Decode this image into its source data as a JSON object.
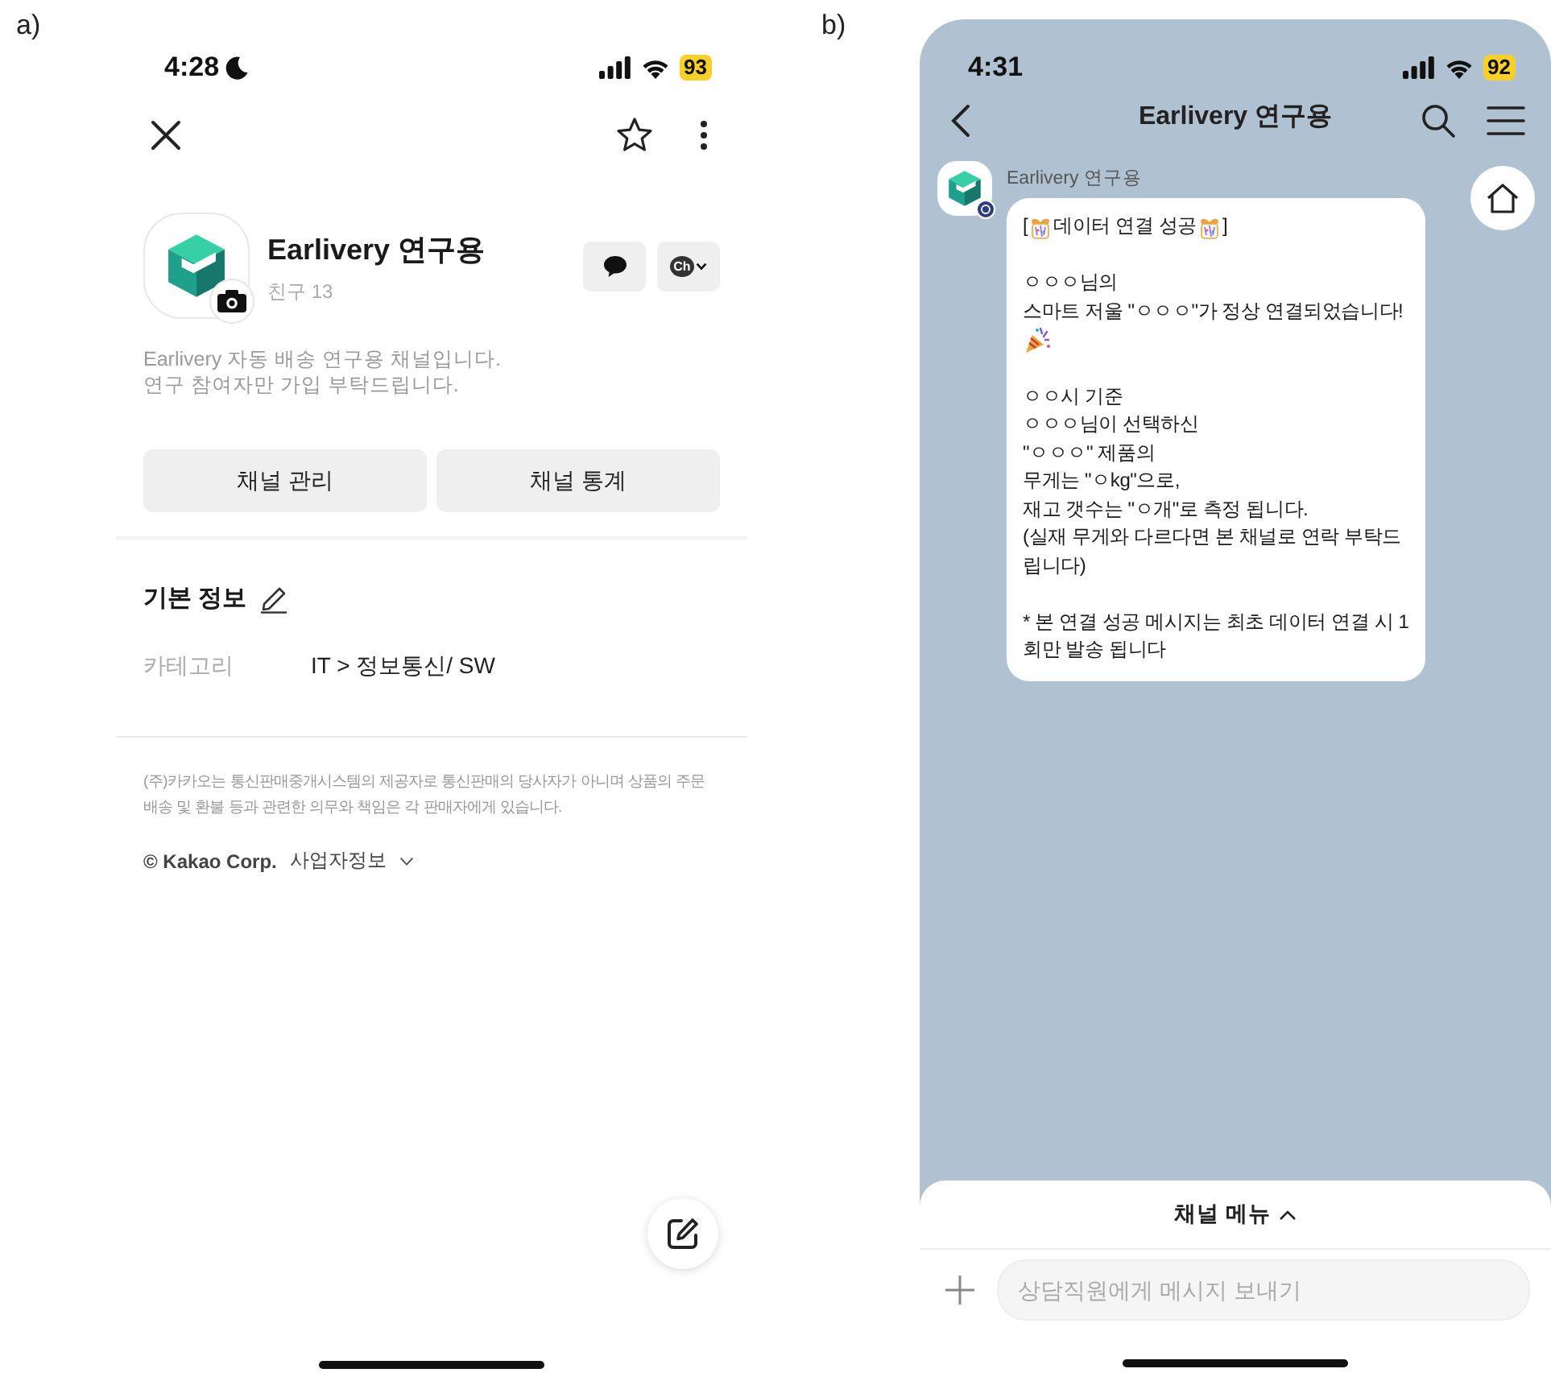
{
  "panel_a": {
    "label": "a)",
    "status_bar": {
      "time": "4:28",
      "battery": "93"
    },
    "profile": {
      "name": "Earlivery 연구용",
      "friends": "친구 13",
      "description": "Earlivery 자동 배송 연구용 채널입니다.\n연구 참여자만 가입 부탁드립니다.",
      "channel_button": "Ch"
    },
    "buttons": [
      "채널 관리",
      "채널 통계"
    ],
    "info": {
      "title": "기본 정보",
      "rows": [
        {
          "label": "카테고리",
          "value": "IT > 정보통신/ SW"
        }
      ]
    },
    "footer": {
      "notice": "(주)카카오는 통신판매중개시스템의 제공자로 통신판매의 당사자가 아니며 상품의 주문\n배송 및 환불 등과 관련한 의무와 책임은 각 판매자에게 있습니다.",
      "copyright": "© Kakao Corp.",
      "link": "사업자정보"
    }
  },
  "panel_b": {
    "label": "b)",
    "status_bar": {
      "time": "4:31",
      "battery": "92"
    },
    "header": {
      "title": "Earlivery 연구용"
    },
    "message": {
      "sender": "Earlivery 연구용",
      "blocks": [
        {
          "kind": "title",
          "open": "[",
          "text": "데이터 연결 성공",
          "close": "]"
        },
        {
          "kind": "text",
          "text": "ㅇㅇㅇ님의\n스마트 저울 \"ㅇㅇㅇ\"가 정상 연결되었습니다!"
        },
        {
          "kind": "popper"
        },
        {
          "kind": "text",
          "text": "ㅇㅇ시 기준\nㅇㅇㅇ님이 선택하신\n\"ㅇㅇㅇ\" 제품의\n무게는 \"ㅇkg\"으로,\n재고 갯수는 \"ㅇ개\"로 측정 됩니다.\n(실재 무게와 다르다면 본 채널로 연락 부탁드\n립니다)"
        },
        {
          "kind": "text",
          "text": "* 본 연결 성공 메시지는 최초 데이터 연결 시 1\n회만 발송 됩니다"
        }
      ]
    },
    "channel_menu": {
      "label": "채널 메뉴"
    },
    "composer": {
      "placeholder": "상담직원에게 메시지 보내기"
    }
  }
}
